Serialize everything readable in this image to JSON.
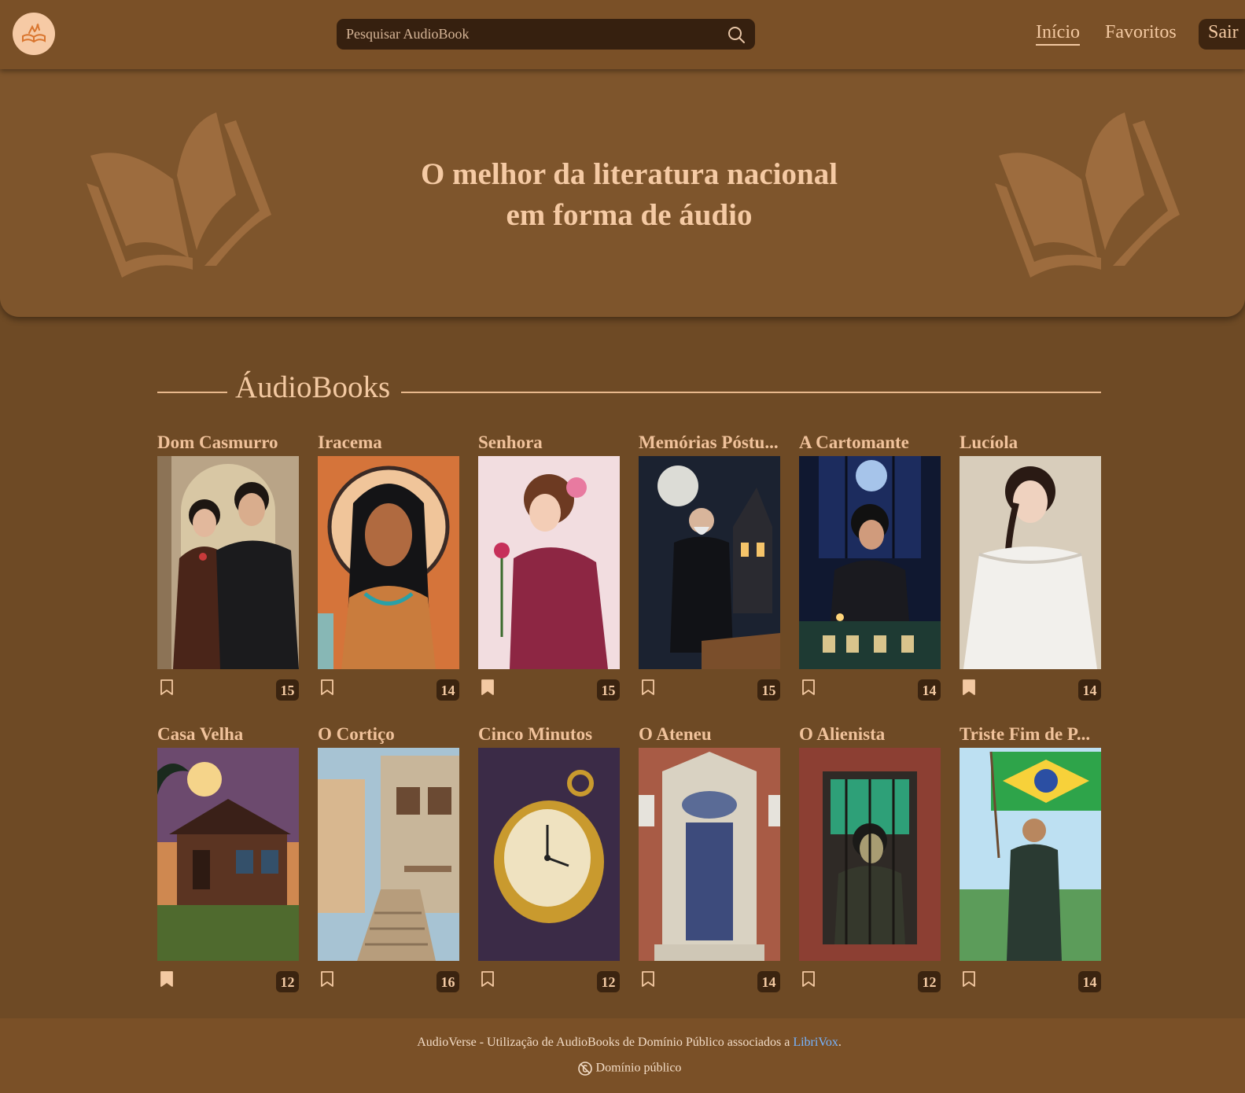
{
  "header": {
    "search_placeholder": "Pesquisar AudioBook",
    "nav": {
      "home": "Início",
      "favorites": "Favoritos",
      "logout": "Sair"
    }
  },
  "hero": {
    "line1": "O melhor da literatura nacional",
    "line2": "em forma de áudio"
  },
  "section": {
    "title": "ÁudioBooks"
  },
  "books": [
    {
      "title": "Dom Casmurro",
      "count": "15",
      "favorited": false
    },
    {
      "title": "Iracema",
      "count": "14",
      "favorited": false
    },
    {
      "title": "Senhora",
      "count": "15",
      "favorited": true
    },
    {
      "title": "Memórias Póstu...",
      "count": "15",
      "favorited": false
    },
    {
      "title": "A Cartomante",
      "count": "14",
      "favorited": false
    },
    {
      "title": "Lucíola",
      "count": "14",
      "favorited": true
    },
    {
      "title": "Casa Velha",
      "count": "12",
      "favorited": true
    },
    {
      "title": "O Cortiço",
      "count": "16",
      "favorited": false
    },
    {
      "title": "Cinco Minutos",
      "count": "12",
      "favorited": false
    },
    {
      "title": "O Ateneu",
      "count": "14",
      "favorited": false
    },
    {
      "title": "O Alienista",
      "count": "12",
      "favorited": false
    },
    {
      "title": "Triste Fim de P...",
      "count": "14",
      "favorited": false
    }
  ],
  "footer": {
    "text_before": "AudioVerse - Utilização de AudioBooks de Domínio Público associados a ",
    "link": "LibriVox",
    "text_after": ".",
    "license": "Domínio público"
  },
  "colors": {
    "background": "#6e4a25",
    "header": "#7a5027",
    "hero": "#7e552c",
    "accent_text": "#f3c9a2",
    "dark_chip": "#3b2410",
    "link": "#76b4ff"
  },
  "icons": {
    "logo": "book-logo-icon",
    "search": "search-icon",
    "bookmark": "bookmark-icon",
    "public_domain": "public-domain-icon"
  }
}
